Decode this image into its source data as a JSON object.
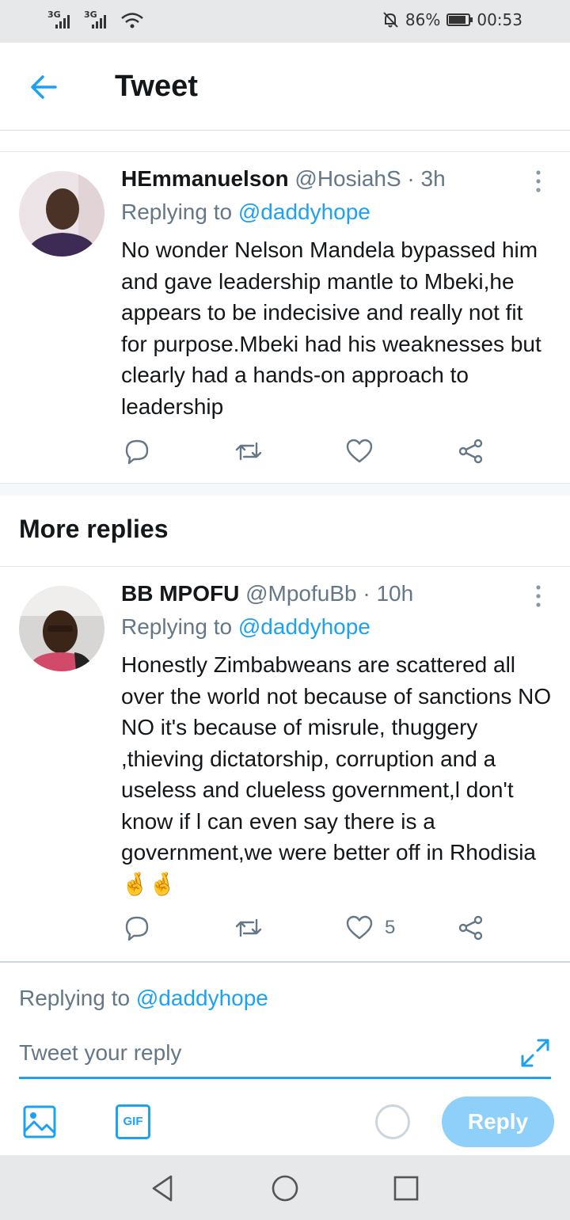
{
  "status_bar": {
    "signal_1": "3G",
    "signal_2": "3G",
    "battery": "86%",
    "time": "00:53"
  },
  "header": {
    "title": "Tweet"
  },
  "tweets": [
    {
      "name": "HEmmanuelson",
      "handle": "@HosiahS · 3h",
      "replying_prefix": "Replying to ",
      "replying_to": "@daddyhope",
      "text": "No wonder Nelson Mandela bypassed him and gave leadership mantle to Mbeki,he appears to be indecisive and really not fit for purpose.Mbeki had his weaknesses but clearly had a hands-on approach to leadership",
      "likes": ""
    },
    {
      "name": "BB MPOFU",
      "handle": "@MpofuBb · 10h",
      "replying_prefix": "Replying to ",
      "replying_to": "@daddyhope",
      "text": "Honestly Zimbabweans are scattered all over the world not because of sanctions NO NO it's because of misrule, thuggery ,thieving dictatorship, corruption and a useless and clueless government,l don't know if l can even say there is a government,we were better off in Rhodisia🤞🤞",
      "likes": "5"
    }
  ],
  "section": {
    "more_replies": "More replies"
  },
  "composer": {
    "replying_prefix": "Replying to ",
    "replying_to": "@daddyhope",
    "placeholder": "Tweet your reply",
    "reply_label": "Reply",
    "gif_label": "GIF"
  },
  "colors": {
    "accent": "#1da1f2",
    "reply_button_disabled": "#8ed0f9",
    "secondary_text": "#657786"
  },
  "icons": [
    "back-arrow-icon",
    "more-vertical-icon",
    "comment-icon",
    "retweet-icon",
    "like-icon",
    "share-icon",
    "image-icon",
    "gif-icon",
    "expand-icon",
    "nav-back-icon",
    "nav-home-icon",
    "nav-recents-icon"
  ]
}
